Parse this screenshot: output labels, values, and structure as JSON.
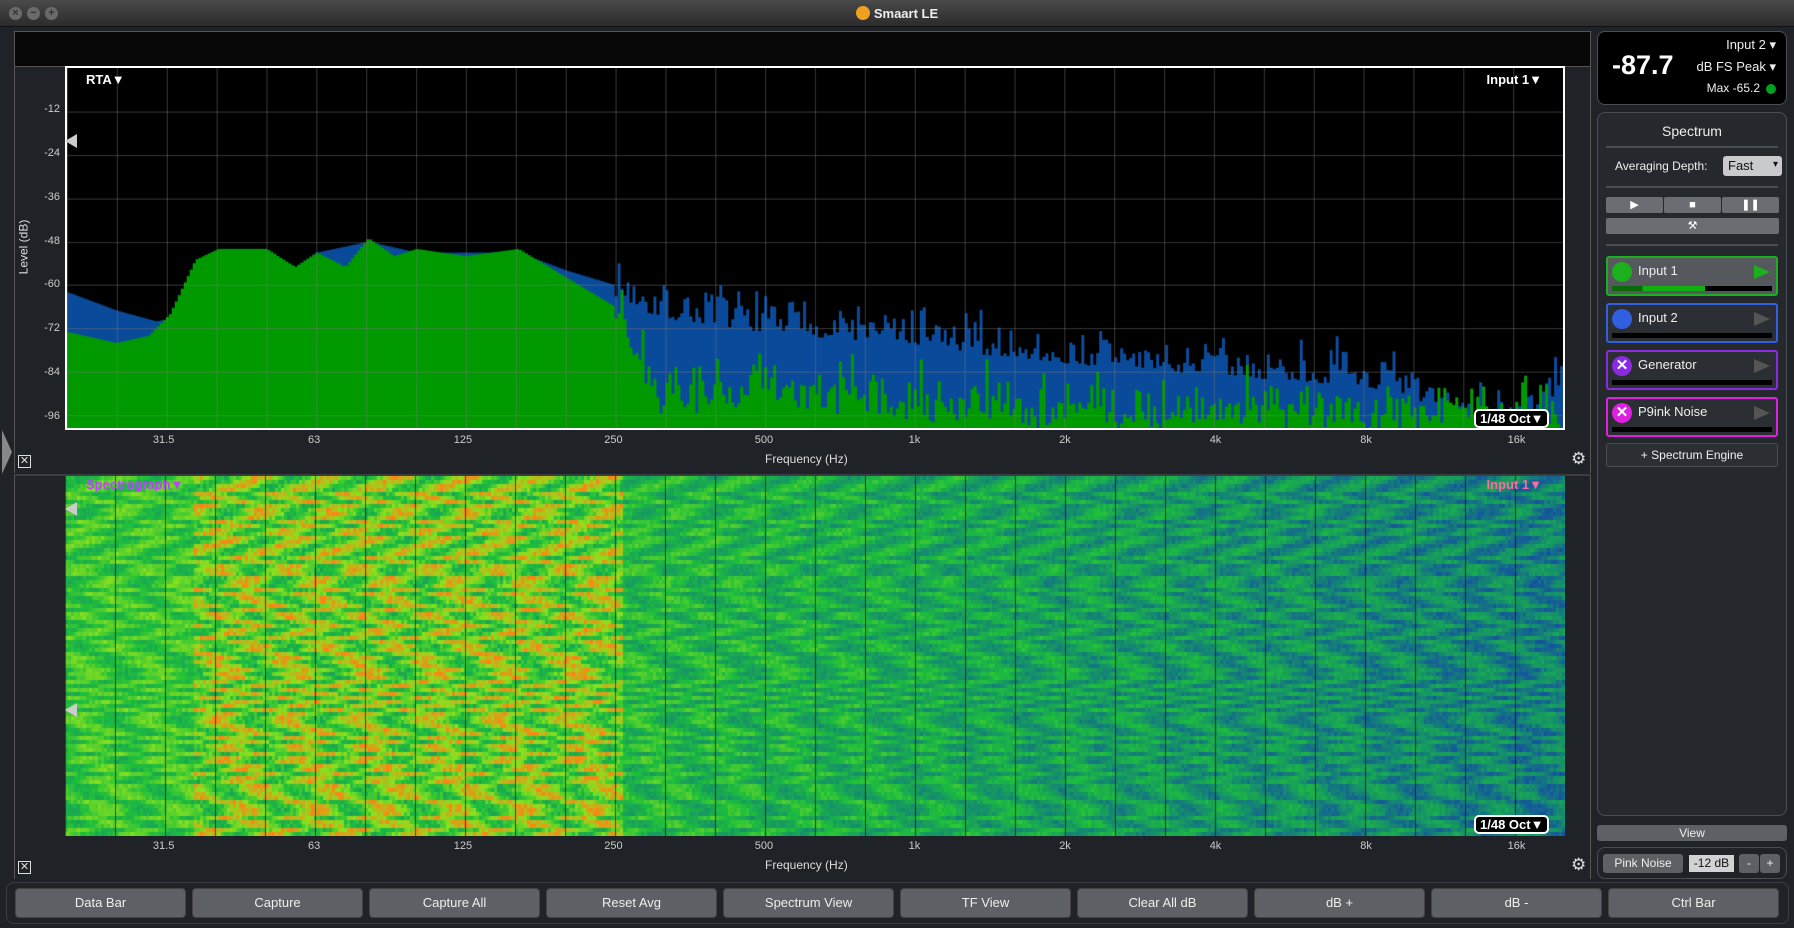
{
  "window": {
    "title": "Smaart LE"
  },
  "rta": {
    "label": "RTA▼",
    "channel": "Input 1▼",
    "resolution": "1/48 Oct▼",
    "ylabel": "Level (dB)",
    "xlabel": "Frequency (Hz)",
    "yticks": [
      "-12",
      "-24",
      "-36",
      "-48",
      "-60",
      "-72",
      "-84",
      "-96"
    ],
    "xticks": [
      "31.5",
      "63",
      "125",
      "250",
      "500",
      "1k",
      "2k",
      "4k",
      "8k",
      "16k"
    ]
  },
  "spectrograph": {
    "label": "Spectrograph▼",
    "channel": "Input 1▼",
    "resolution": "1/48 Oct▼",
    "xlabel": "Frequency (Hz)",
    "xticks": [
      "31.5",
      "63",
      "125",
      "250",
      "500",
      "1k",
      "2k",
      "4k",
      "8k",
      "16k"
    ]
  },
  "chart_data": {
    "type": "area",
    "xscale": "log",
    "xlim": [
      20,
      20000
    ],
    "ylim": [
      -99.5,
      0
    ],
    "xlabel": "Frequency (Hz)",
    "ylabel": "Level (dB)",
    "series": [
      {
        "name": "Input 2",
        "color": "#0a4a9a",
        "points": [
          [
            20,
            -62
          ],
          [
            25,
            -67
          ],
          [
            30,
            -70
          ],
          [
            33,
            -69
          ],
          [
            36,
            -55
          ],
          [
            40,
            -50
          ],
          [
            50,
            -50
          ],
          [
            57,
            -55
          ],
          [
            63,
            -51
          ],
          [
            80,
            -48
          ],
          [
            100,
            -51
          ],
          [
            125,
            -51
          ],
          [
            160,
            -51
          ],
          [
            200,
            -56
          ],
          [
            250,
            -60
          ],
          [
            300,
            -66
          ],
          [
            500,
            -70
          ],
          [
            1000,
            -74
          ],
          [
            2000,
            -79
          ],
          [
            4000,
            -82
          ],
          [
            8000,
            -85
          ],
          [
            12000,
            -93
          ],
          [
            16000,
            -96
          ],
          [
            20000,
            -86
          ]
        ]
      },
      {
        "name": "Input 1",
        "color": "#009a00",
        "points": [
          [
            20,
            -73
          ],
          [
            25,
            -76
          ],
          [
            29,
            -74
          ],
          [
            32,
            -68
          ],
          [
            36,
            -53
          ],
          [
            40,
            -50
          ],
          [
            50,
            -50
          ],
          [
            57,
            -55
          ],
          [
            63,
            -51
          ],
          [
            72,
            -55
          ],
          [
            80,
            -47
          ],
          [
            90,
            -52
          ],
          [
            100,
            -50
          ],
          [
            125,
            -52
          ],
          [
            160,
            -50
          ],
          [
            200,
            -58
          ],
          [
            250,
            -66
          ],
          [
            280,
            -80
          ],
          [
            300,
            -93
          ],
          [
            500,
            -92
          ],
          [
            1000,
            -97
          ],
          [
            2000,
            -98
          ],
          [
            8000,
            -98
          ],
          [
            20000,
            -99
          ]
        ]
      }
    ]
  },
  "meter": {
    "value": "-87.7",
    "channel": "Input 2",
    "mode": "dB FS Peak",
    "max": "Max -65.2",
    "status_color": "#00a020"
  },
  "spectrum_panel": {
    "title": "Spectrum",
    "avg_label": "Averaging Depth:",
    "avg_value": "Fast",
    "channels": [
      {
        "label": "Input 1",
        "color": "#1cb01c",
        "level": 0.58
      },
      {
        "label": "Input 2",
        "color": "#3060e0",
        "level": 0
      },
      {
        "label": "Generator",
        "color": "#8a2be2",
        "level": 0
      },
      {
        "label": "P9ink Noise",
        "color": "#e020e0",
        "level": 0
      }
    ],
    "add_engine": "+ Spectrum Engine"
  },
  "view_button": "View",
  "generator": {
    "signal": "Pink Noise",
    "level": "-12 dB",
    "minus": "-",
    "plus": "+"
  },
  "bottom_bar": [
    "Data Bar",
    "Capture",
    "Capture All",
    "Reset Avg",
    "Spectrum View",
    "TF View",
    "Clear All dB",
    "dB +",
    "dB -",
    "Ctrl Bar"
  ]
}
